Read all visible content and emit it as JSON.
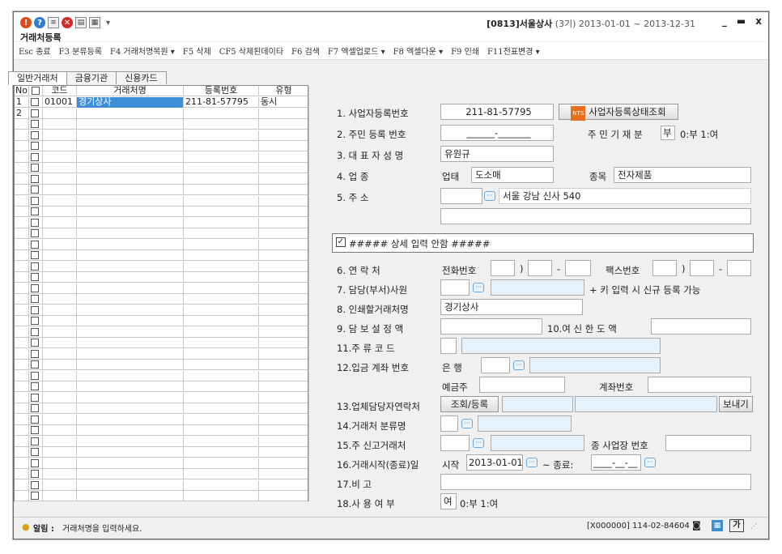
{
  "app": {
    "title": "거래처등록",
    "company_code": "[0813]",
    "company_name": "서울상사",
    "period": "(3기) 2013-01-01 ~ 2013-12-31",
    "minimize": "_",
    "maximize": "▬",
    "close": "x"
  },
  "toolbar": [
    "Esc 종료",
    "F3 분류등록",
    "F4 거래처명복원 ▾",
    "F5 삭제",
    "CF5 삭제된데이타",
    "F6 검색",
    "F7 엑셀업로드 ▾",
    "F8 엑셀다운 ▾",
    "F9 인쇄",
    "F11전표변경 ▾"
  ],
  "tabs": [
    "일반거래처",
    "금융기관",
    "신용카드"
  ],
  "grid": {
    "headers": [
      "No",
      "",
      "코드",
      "거래처명",
      "등록번호",
      "유형"
    ],
    "rows": [
      {
        "no": "1",
        "code": "01001",
        "name": "경기상사",
        "reg": "211-81-57795",
        "type": "동시"
      },
      {
        "no": "2",
        "code": "",
        "name": "",
        "reg": "",
        "type": ""
      }
    ]
  },
  "form": {
    "biz_no_label": "1. 사업자등록번호",
    "biz_no": "211-81-57795",
    "biz_status_btn": "사업자등록상태조회",
    "nts_icon": "NTS",
    "resident_label": "2. 주민 등록 번호",
    "resident_no": "______-_______",
    "resident_flag_label": "주 민 기 재 분",
    "resident_flag": "부",
    "resident_flag_hint": "0:부 1:여",
    "ceo_label": "3. 대 표 자 성 명",
    "ceo": "유원규",
    "biz_type_label": "4. 업          종",
    "upte_label": "업태",
    "upte": "도소매",
    "jongmok_label": "종목",
    "jongmok": "전자제품",
    "address_label": "5. 주          소",
    "address": "서울 강남 신사 540",
    "detail_toggle": "##### 상세 입력 안함 #####",
    "contact_label": "6. 연    락    처",
    "phone_label": "전화번호",
    "paren": ")",
    "dash": "-",
    "fax_label": "팩스번호",
    "manager_label": "7. 담당(부서)사원",
    "manager_hint": "+ 키 입력 시 신규 등록 가능",
    "print_name_label": "8. 인쇄할거래처명",
    "print_name": "경기상사",
    "collateral_label": "9. 담 보 설 정 액",
    "credit_label": "10.여 신 한 도 액",
    "liquor_label": "11.주  류  코  드",
    "account_label": "12.입금 계좌 번호",
    "bank_label": "은  행",
    "depositor_label": "예금주",
    "account_no_label": "계좌번호",
    "vendor_contact_label": "13.업체담당자연락처",
    "lookup_btn": "조회/등록",
    "send_btn": "보내기",
    "category_label": "14.거래처 분류명",
    "tax_main_label": "15.주 신고거래처",
    "branch_label": "종 사업장 번호",
    "period_label": "16.거래시작(종료)일",
    "start_label": "시작",
    "start_date": "2013-01-01",
    "end_sep": "~ 종료:",
    "end_date": "____-__-__",
    "memo_label": "17.비        고",
    "use_label": "18.사 용 여 부",
    "use_value": "여",
    "use_hint": "0:부 1:여"
  },
  "status": {
    "alert_label": "알림 :",
    "alert_text": "거래처명을 입력하세요.",
    "code_info": "[X000000] 114-02-84604",
    "key_btn": "가"
  }
}
